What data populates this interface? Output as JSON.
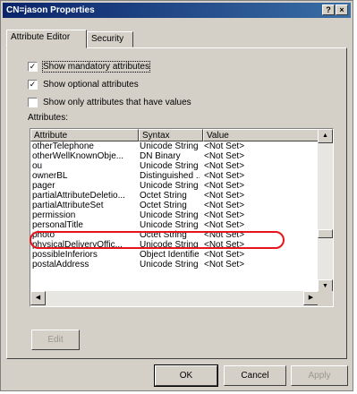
{
  "window": {
    "title": "CN=jason Properties",
    "help_button": "?",
    "close_button": "×"
  },
  "tabs": [
    {
      "label": "Attribute Editor",
      "active": true
    },
    {
      "label": "Security",
      "active": false
    }
  ],
  "options": {
    "show_mandatory": {
      "label": "Show mandatory attributes",
      "checked": true
    },
    "show_optional": {
      "label": "Show optional attributes",
      "checked": true
    },
    "show_only_values": {
      "label": "Show only attributes that have values",
      "checked": false
    }
  },
  "attributes_label": "Attributes:",
  "attributes_table": {
    "columns": [
      "Attribute",
      "Syntax",
      "Value"
    ],
    "rows": [
      {
        "attribute": "otherTelephone",
        "syntax": "Unicode String",
        "value": "<Not Set>"
      },
      {
        "attribute": "otherWellKnownObje...",
        "syntax": "DN Binary",
        "value": "<Not Set>"
      },
      {
        "attribute": "ou",
        "syntax": "Unicode String",
        "value": "<Not Set>"
      },
      {
        "attribute": "ownerBL",
        "syntax": "Distinguished ...",
        "value": "<Not Set>"
      },
      {
        "attribute": "pager",
        "syntax": "Unicode String",
        "value": "<Not Set>"
      },
      {
        "attribute": "partialAttributeDeletio...",
        "syntax": "Octet String",
        "value": "<Not Set>"
      },
      {
        "attribute": "partialAttributeSet",
        "syntax": "Octet String",
        "value": "<Not Set>"
      },
      {
        "attribute": "permission",
        "syntax": "Unicode String",
        "value": "<Not Set>"
      },
      {
        "attribute": "personalTitle",
        "syntax": "Unicode String",
        "value": "<Not Set>"
      },
      {
        "attribute": "photo",
        "syntax": "Octet String",
        "value": "<Not Set>"
      },
      {
        "attribute": "physicalDeliveryOffic...",
        "syntax": "Unicode String",
        "value": "<Not Set>"
      },
      {
        "attribute": "possibleInferiors",
        "syntax": "Object Identifier",
        "value": "<Not Set>"
      },
      {
        "attribute": "postalAddress",
        "syntax": "Unicode String",
        "value": "<Not Set>"
      }
    ]
  },
  "highlight_color": "#e8141b",
  "buttons": {
    "edit": "Edit",
    "ok": "OK",
    "cancel": "Cancel",
    "apply": "Apply"
  }
}
